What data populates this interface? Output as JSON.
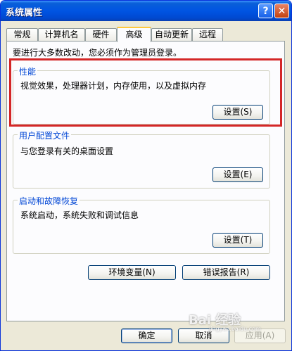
{
  "window": {
    "title": "系统属性",
    "help_label": "?",
    "close_label": "✕"
  },
  "tabs": [
    {
      "label": "常规"
    },
    {
      "label": "计算机名"
    },
    {
      "label": "硬件"
    },
    {
      "label": "高级",
      "active": true
    },
    {
      "label": "自动更新"
    },
    {
      "label": "远程"
    }
  ],
  "notice": "要进行大多数改动，您必须作为管理员登录。",
  "performance": {
    "title": "性能",
    "description": "视觉效果，处理器计划，内存使用，以及虚拟内存",
    "button": "设置(S)"
  },
  "user_profiles": {
    "title": "用户配置文件",
    "description": "与您登录有关的桌面设置",
    "button": "设置(E)"
  },
  "startup_recovery": {
    "title": "启动和故障恢复",
    "description": "系统启动，系统失败和调试信息",
    "button": "设置(T)"
  },
  "env_button": "环境变量(N)",
  "error_report_button": "错误报告(R)",
  "dialog": {
    "ok": "确定",
    "cancel": "取消",
    "apply": "应用(A)"
  },
  "watermark": {
    "text": "Bai 经验",
    "sub": "jingyan.baidu.com"
  },
  "colors": {
    "titlebar": "#0054e3",
    "group_title": "#0046d5",
    "highlight_box": "#d42727",
    "active_tab_accent": "#ffc83c"
  }
}
